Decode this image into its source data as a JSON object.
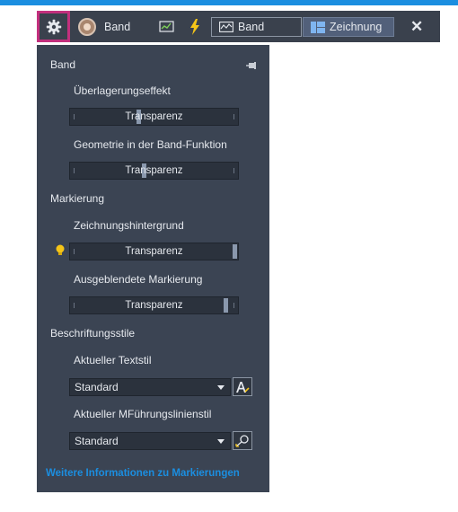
{
  "colors": {
    "accent": "#1b8ee0",
    "highlight": "#c2307d",
    "panel": "#3b4453",
    "toolbar": "#3a414d"
  },
  "toolbar": {
    "gear_icon": "gear-icon",
    "user_label": "Band",
    "tab_band": "Band",
    "tab_drawing": "Zeichnung",
    "close_icon": "close-icon"
  },
  "panel": {
    "band": {
      "title": "Band",
      "overlay_label": "Überlagerungseffekt",
      "overlay_slider": {
        "text": "Transparenz",
        "value_pct": 40
      },
      "geometry_label": "Geometrie in der Band-Funktion",
      "geometry_slider": {
        "text": "Transparenz",
        "value_pct": 43
      }
    },
    "markup": {
      "title": "Markierung",
      "bg_label": "Zeichnungshintergrund",
      "bg_slider": {
        "text": "Transparenz",
        "value_pct": 98
      },
      "hidden_label": "Ausgeblendete Markierung",
      "hidden_slider": {
        "text": "Transparenz",
        "value_pct": 93
      }
    },
    "styles": {
      "title": "Beschriftungsstile",
      "text_label": "Aktueller Textstil",
      "text_value": "Standard",
      "mleader_label": "Aktueller MFührungslinienstil",
      "mleader_value": "Standard"
    },
    "link": "Weitere Informationen zu Markierungen"
  }
}
